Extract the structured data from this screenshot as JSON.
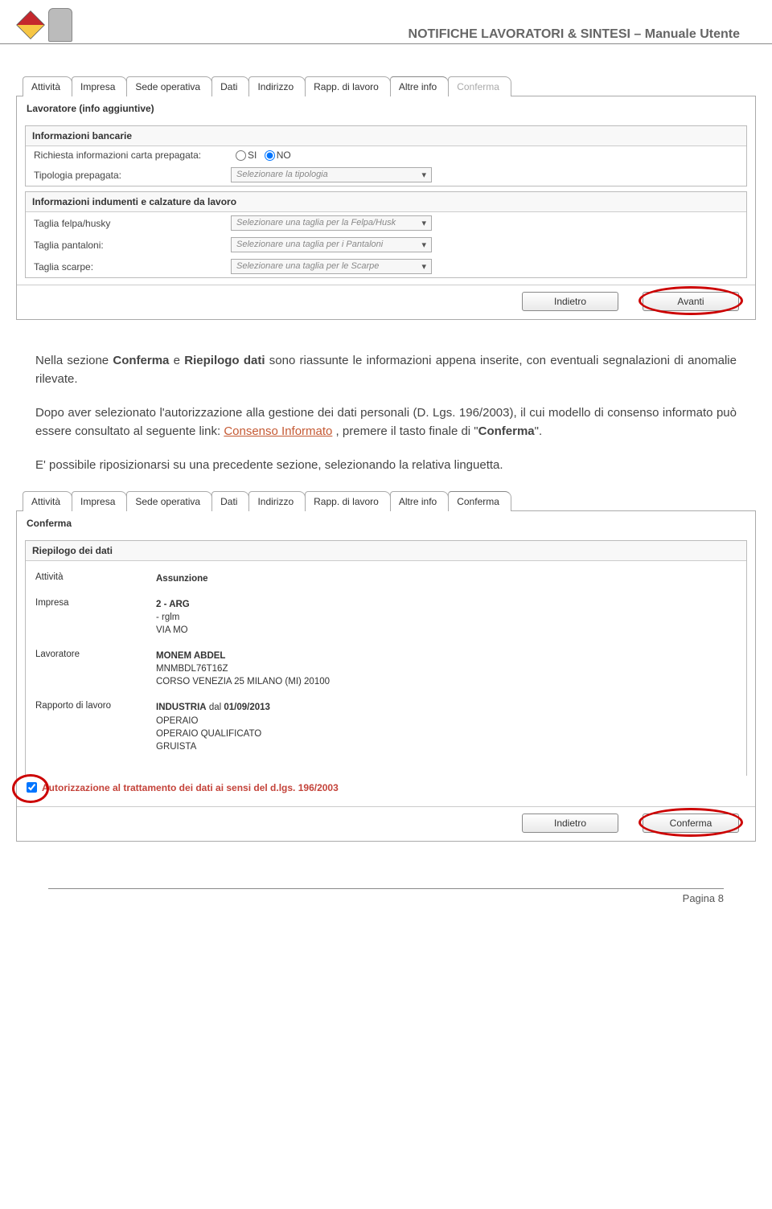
{
  "header": {
    "title": "NOTIFICHE LAVORATORI & SINTESI – Manuale Utente"
  },
  "shot1": {
    "tabs": [
      "Attività",
      "Impresa",
      "Sede operativa",
      "Dati",
      "Indirizzo",
      "Rapp. di lavoro",
      "Altre info",
      "Conferma"
    ],
    "active_tab": 6,
    "section": "Lavoratore (info aggiuntive)",
    "group1_title": "Informazioni bancarie",
    "row_prepaid_label": "Richiesta informazioni carta prepagata:",
    "radio_si": "SI",
    "radio_no": "NO",
    "row_type_label": "Tipologia prepagata:",
    "row_type_placeholder": "Selezionare la tipologia",
    "group2_title": "Informazioni indumenti e calzature da lavoro",
    "felpa_label": "Taglia felpa/husky",
    "felpa_placeholder": "Selezionare una taglia per la Felpa/Husk",
    "pant_label": "Taglia pantaloni:",
    "pant_placeholder": "Selezionare una taglia per i Pantaloni",
    "scarpe_label": "Taglia scarpe:",
    "scarpe_placeholder": "Selezionare una taglia per le Scarpe",
    "btn_back": "Indietro",
    "btn_next": "Avanti"
  },
  "paras": {
    "p1a": "Nella sezione ",
    "p1b": "Conferma",
    "p1c": " e ",
    "p1d": "Riepilogo dati",
    "p1e": " sono riassunte le informazioni appena inserite, con eventuali segnalazioni di anomalie rilevate.",
    "p2a": "Dopo aver selezionato l'autorizzazione alla gestione dei dati personali (D. Lgs. 196/2003), il cui modello di consenso informato può essere consultato al seguente link: ",
    "p2link": "Consenso Informato",
    "p2b": " , premere il tasto finale di \"",
    "p2c": "Conferma",
    "p2d": "\".",
    "p3": "E' possibile riposizionarsi su una precedente sezione, selezionando la relativa linguetta."
  },
  "shot2": {
    "tabs": [
      "Attività",
      "Impresa",
      "Sede operativa",
      "Dati",
      "Indirizzo",
      "Rapp. di lavoro",
      "Altre info",
      "Conferma"
    ],
    "active_tab": 7,
    "section": "Conferma",
    "riep_title": "Riepilogo dei dati",
    "rows": [
      {
        "label": "Attività",
        "lines": [
          {
            "b": "Assunzione"
          }
        ]
      },
      {
        "label": "Impresa",
        "lines": [
          {
            "b": "2 - ARG"
          },
          {
            "t": "- rglm"
          },
          {
            "t": "VIA MO"
          }
        ]
      },
      {
        "label": "Lavoratore",
        "lines": [
          {
            "b": "MONEM ABDEL"
          },
          {
            "t": "MNMBDL76T16Z"
          },
          {
            "t": "CORSO VENEZIA 25 MILANO (MI) 20100"
          }
        ]
      },
      {
        "label": "Rapporto di lavoro",
        "lines": [
          {
            "bmix": [
              "INDUSTRIA",
              " dal ",
              "01/09/2013"
            ]
          },
          {
            "t": "OPERAIO"
          },
          {
            "t": "OPERAIO QUALIFICATO"
          },
          {
            "t": "GRUISTA"
          }
        ]
      }
    ],
    "auth_text": "Autorizzazione al trattamento dei dati ai sensi del d.lgs. 196/2003",
    "btn_back": "Indietro",
    "btn_confirm": "Conferma"
  },
  "footer": {
    "label": "Pagina",
    "num": "8"
  }
}
